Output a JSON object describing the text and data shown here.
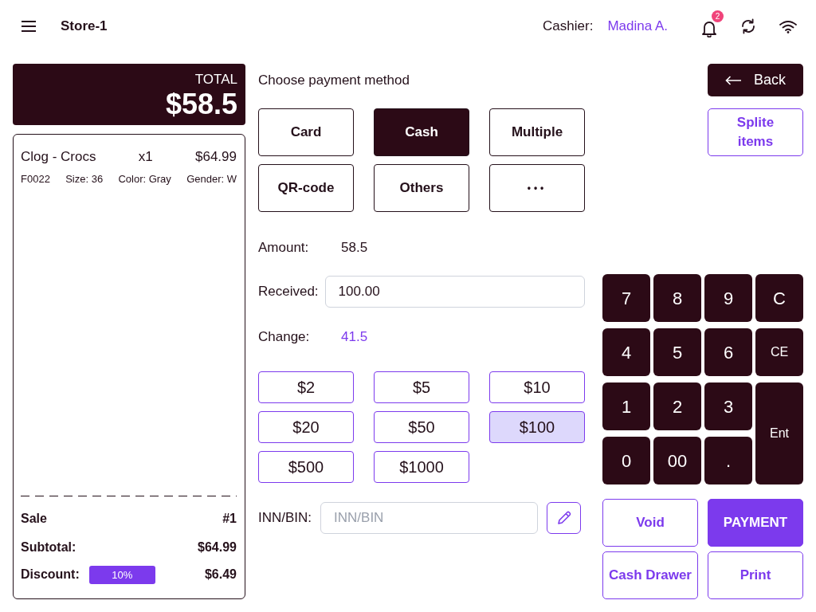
{
  "header": {
    "store": "Store-1",
    "cashier_label": "Cashier:",
    "cashier_name": "Madina A.",
    "notifications": "2"
  },
  "total": {
    "label": "TOTAL",
    "amount": "$58.5"
  },
  "receipt": {
    "items": [
      {
        "name": "Clog - Crocs",
        "quantity": "x1",
        "price": "$64.99",
        "details": [
          "F0022",
          "Size: 36",
          "Color: Gray",
          "Gender: W"
        ]
      }
    ],
    "sale": {
      "label": "Sale",
      "value": "#1"
    },
    "subtotal": {
      "label": "Subtotal:",
      "value": "$64.99"
    },
    "discount": {
      "label": "Discount:",
      "badge": "10%",
      "value": "$6.49"
    }
  },
  "payment": {
    "title": "Choose payment method",
    "methods": [
      {
        "label": "Card",
        "selected": false
      },
      {
        "label": "Cash",
        "selected": true
      },
      {
        "label": "Multiple",
        "selected": false
      },
      {
        "label": "QR-code",
        "selected": false
      },
      {
        "label": "Others",
        "selected": false
      },
      {
        "label": "•••",
        "selected": false
      }
    ],
    "amount": {
      "label": "Amount:",
      "value": "58.5"
    },
    "received": {
      "label": "Received:",
      "value": "100.00"
    },
    "change": {
      "label": "Change:",
      "value": "41.5"
    },
    "quick_amounts": [
      {
        "label": "$2",
        "selected": false
      },
      {
        "label": "$5",
        "selected": false
      },
      {
        "label": "$10",
        "selected": false
      },
      {
        "label": "$20",
        "selected": false
      },
      {
        "label": "$50",
        "selected": false
      },
      {
        "label": "$100",
        "selected": true
      },
      {
        "label": "$500",
        "selected": false
      },
      {
        "label": "$1000",
        "selected": false
      }
    ],
    "tax_id": {
      "label": "INN/BIN:",
      "placeholder": "INN/BIN"
    }
  },
  "actions": {
    "back": "Back",
    "split": "Splite items"
  },
  "keypad": [
    {
      "label": "7",
      "kind": "key"
    },
    {
      "label": "8",
      "kind": "key"
    },
    {
      "label": "9",
      "kind": "key"
    },
    {
      "label": "C",
      "kind": "key"
    },
    {
      "label": "4",
      "kind": "key"
    },
    {
      "label": "5",
      "kind": "key"
    },
    {
      "label": "6",
      "kind": "key"
    },
    {
      "label": "CE",
      "kind": "small"
    },
    {
      "label": "1",
      "kind": "key"
    },
    {
      "label": "2",
      "kind": "key"
    },
    {
      "label": "3",
      "kind": "key"
    },
    {
      "label": "Ent",
      "kind": "enter"
    },
    {
      "label": "0",
      "kind": "key"
    },
    {
      "label": "00",
      "kind": "key"
    },
    {
      "label": ".",
      "kind": "key"
    }
  ],
  "footer_buttons": [
    {
      "label": "Void",
      "kind": "outline"
    },
    {
      "label": "PAYMENT",
      "kind": "primary"
    },
    {
      "label": "Cash Drawer",
      "kind": "outline"
    },
    {
      "label": "Print",
      "kind": "outline"
    }
  ]
}
